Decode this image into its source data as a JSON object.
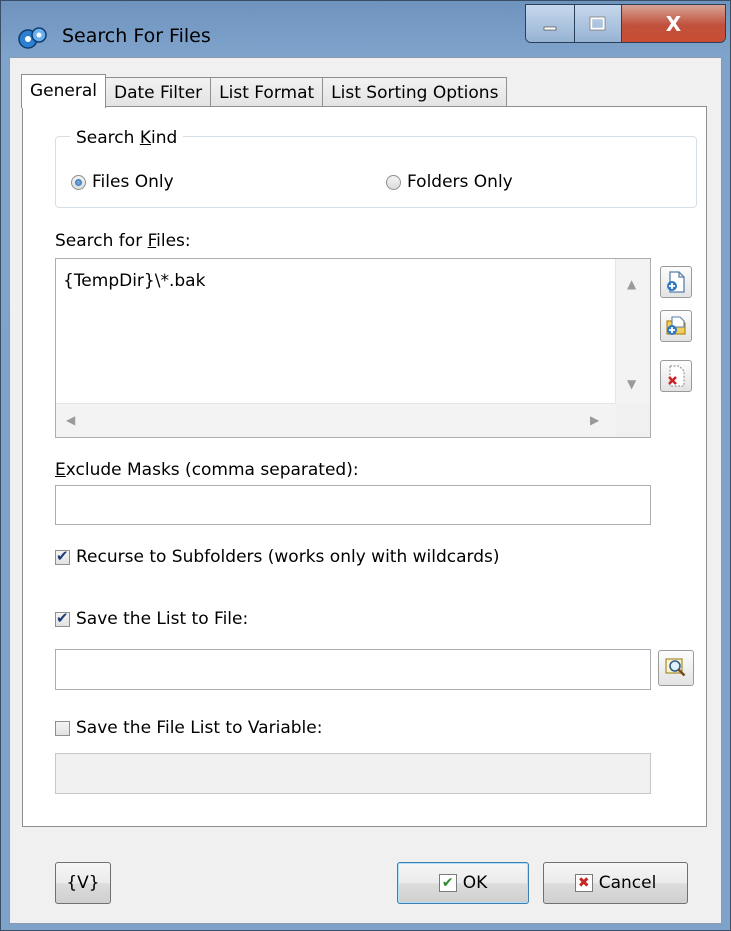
{
  "window": {
    "title": "Search For Files",
    "caption": {
      "minimize": "▁",
      "maximize": "☐",
      "close": "X"
    }
  },
  "tabs": [
    {
      "label": "General",
      "active": true
    },
    {
      "label": "Date Filter",
      "active": false
    },
    {
      "label": "List Format",
      "active": false
    },
    {
      "label": "List Sorting Options",
      "active": false
    }
  ],
  "search_kind": {
    "label_pre": "Search ",
    "label_accel": "K",
    "label_post": "ind",
    "options": [
      {
        "label": "Files Only",
        "selected": true
      },
      {
        "label": "Folders Only",
        "selected": false
      }
    ]
  },
  "search_files": {
    "label_pre": "Search for ",
    "label_accel": "F",
    "label_post": "iles:",
    "value": "{TempDir}\\*.bak"
  },
  "exclude": {
    "label_accel": "E",
    "label_post": "xclude Masks (comma separated):",
    "value": ""
  },
  "recurse": {
    "label": "Recurse to Subfolders (works only with wildcards)",
    "checked": true
  },
  "save_list": {
    "label": "Save the List to File:",
    "checked": true,
    "value": ""
  },
  "save_variable": {
    "label": "Save the File List to Variable:",
    "checked": false,
    "value": ""
  },
  "footer": {
    "variables_label": "{V}",
    "ok_label": "OK",
    "cancel_label": "Cancel"
  },
  "colors": {
    "titlebar": "#7ea2c9",
    "close": "#c94d33",
    "ok_mark": "#2f8a2f",
    "cancel_mark": "#c62828"
  }
}
